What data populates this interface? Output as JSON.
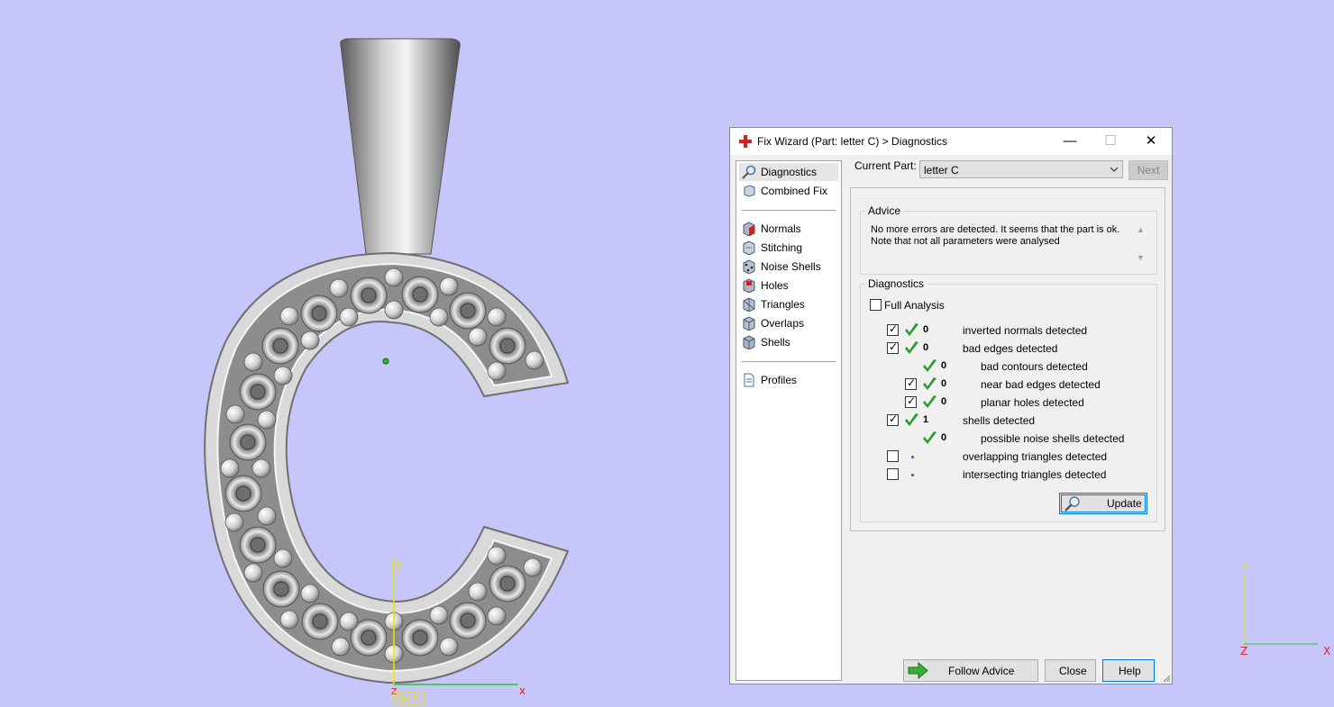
{
  "viewport": {
    "background": "#c6c6fb",
    "main_axes": {
      "y": "y",
      "x": "x",
      "z": "z",
      "label": "WCS"
    },
    "corner_axes": {
      "y": "Y",
      "x": "X",
      "z": "Z"
    }
  },
  "dialog": {
    "title": "Fix Wizard (Part: letter C) > Diagnostics",
    "window_controls": {
      "minimize": "—",
      "maximize": "☐",
      "close": "✕"
    },
    "nav": {
      "group1": [
        {
          "label": "Diagnostics",
          "icon": "magnifier-icon",
          "selected": true
        },
        {
          "label": "Combined Fix",
          "icon": "combined-fix-icon"
        }
      ],
      "group2": [
        {
          "label": "Normals",
          "icon": "normals-icon"
        },
        {
          "label": "Stitching",
          "icon": "stitching-icon"
        },
        {
          "label": "Noise Shells",
          "icon": "noise-shells-icon"
        },
        {
          "label": "Holes",
          "icon": "holes-icon"
        },
        {
          "label": "Triangles",
          "icon": "triangles-icon"
        },
        {
          "label": "Overlaps",
          "icon": "overlaps-icon"
        },
        {
          "label": "Shells",
          "icon": "shells-icon"
        }
      ],
      "group3": [
        {
          "label": "Profiles",
          "icon": "profiles-icon"
        }
      ]
    },
    "current_part_label": "Current Part:",
    "current_part_value": "letter C",
    "next_label": "Next",
    "advice": {
      "title": "Advice",
      "text": "No more errors are detected. It seems that the part is ok. Note that not all parameters were analysed"
    },
    "diagnostics": {
      "title": "Diagnostics",
      "full_analysis_label": "Full Analysis",
      "rows": [
        {
          "checkbox": true,
          "checked": true,
          "status": "ok",
          "count": "0",
          "label": "inverted normals detected",
          "indent": 0
        },
        {
          "checkbox": true,
          "checked": true,
          "status": "ok",
          "count": "0",
          "label": "bad edges detected",
          "indent": 0
        },
        {
          "checkbox": false,
          "checked": false,
          "status": "ok",
          "count": "0",
          "label": "bad contours detected",
          "indent": 1
        },
        {
          "checkbox": true,
          "checked": true,
          "status": "ok",
          "count": "0",
          "label": "near bad edges detected",
          "indent": 1
        },
        {
          "checkbox": true,
          "checked": true,
          "status": "ok",
          "count": "0",
          "label": "planar holes detected",
          "indent": 1
        },
        {
          "checkbox": true,
          "checked": true,
          "status": "ok",
          "count": "1",
          "label": "shells detected",
          "indent": 0
        },
        {
          "checkbox": false,
          "checked": false,
          "status": "ok",
          "count": "0",
          "label": "possible noise shells detected",
          "indent": 1
        },
        {
          "checkbox": true,
          "checked": false,
          "status": "pending",
          "count": "",
          "label": "overlapping triangles detected",
          "indent": 0
        },
        {
          "checkbox": true,
          "checked": false,
          "status": "pending",
          "count": "",
          "label": "intersecting triangles detected",
          "indent": 0
        }
      ],
      "update_label": "Update"
    },
    "follow_advice_label": "Follow Advice",
    "close_label": "Close",
    "help_label": "Help"
  }
}
